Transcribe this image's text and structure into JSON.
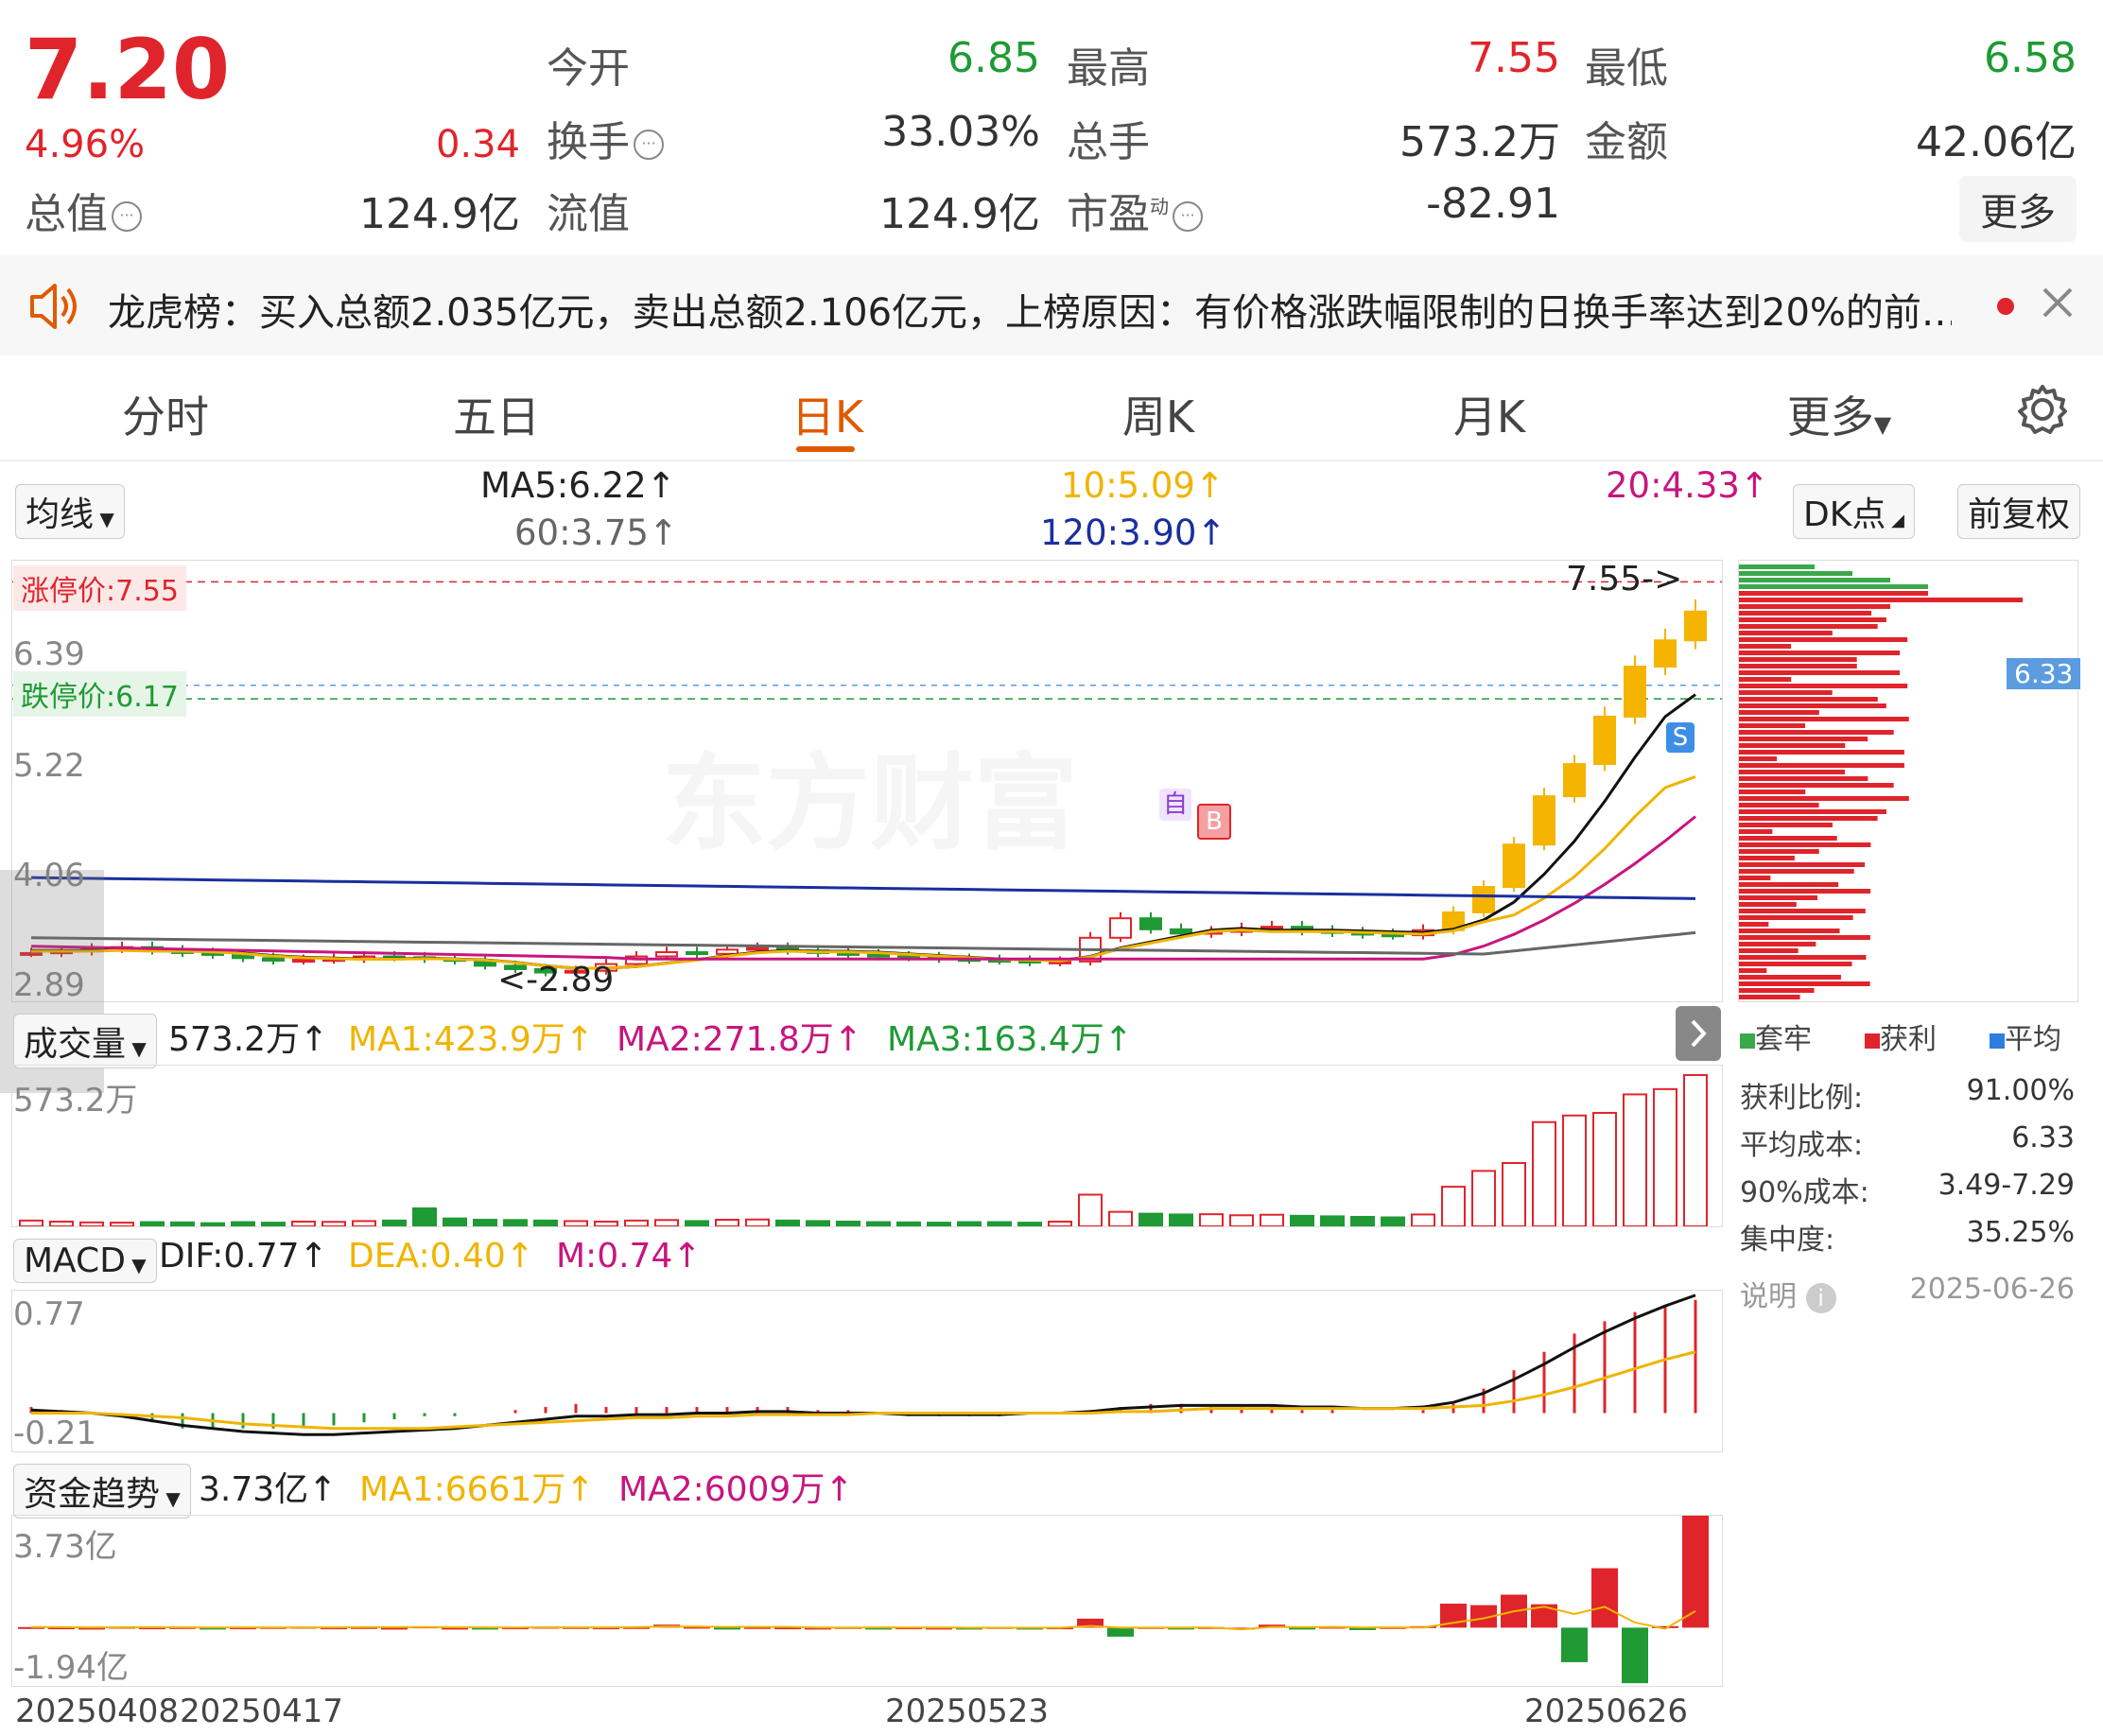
{
  "quote": {
    "price": "7.20",
    "change_pct": "4.96%",
    "change": "0.34",
    "total_value_label": "总值",
    "total_value": "124.9亿",
    "open_label": "今开",
    "open": "6.85",
    "high_label": "最高",
    "high": "7.55",
    "low_label": "最低",
    "low": "6.58",
    "turnover_label": "换手",
    "turnover": "33.03%",
    "volume_label": "总手",
    "volume": "573.2万",
    "amount_label": "金额",
    "amount": "42.06亿",
    "float_label": "流值",
    "float_value": "124.9亿",
    "pe_label": "市盈",
    "pe_sup": "动",
    "pe": "-82.91",
    "more_label": "更多"
  },
  "notice": {
    "text": "龙虎榜：买入总额2.035亿元，卖出总额2.106亿元，上榜原因：有价格涨跌幅限制的日换手率达到20%的前…",
    "dot_color": "#e0242b"
  },
  "tabs": [
    {
      "label": "分时"
    },
    {
      "label": "五日"
    },
    {
      "label": "日K"
    },
    {
      "label": "周K"
    },
    {
      "label": "月K"
    },
    {
      "label": "更多"
    }
  ],
  "active_tab": "日K",
  "ma_bar": {
    "selector": "均线",
    "ma5": "MA5:6.22↑",
    "ma10": "10:5.09↑",
    "ma20": "20:4.33↑",
    "ma60": "60:3.75↑",
    "ma120": "120:3.90↑",
    "dk_label": "DK点",
    "adjust_label": "前复权"
  },
  "kline": {
    "limit_up": "涨停价:7.55",
    "limit_down": "跌停价:6.17",
    "y_ticks": [
      "6.39",
      "5.22",
      "4.06",
      "2.89"
    ],
    "high_marker": "7.55->",
    "low_marker": "<-2.89",
    "watermark": "东方财富",
    "marker_s": "S",
    "marker_b": "B",
    "marker_zi": "自"
  },
  "chip": {
    "cost_tag": "6.33",
    "legend": [
      "套牢",
      "获利",
      "平均"
    ],
    "rows": [
      {
        "label": "获利比例:",
        "value": "91.00%"
      },
      {
        "label": "平均成本:",
        "value": "6.33"
      },
      {
        "label": "90%成本:",
        "value": "3.49-7.29"
      },
      {
        "label": "集中度:",
        "value": "35.25%"
      }
    ],
    "note_label": "说明",
    "date": "2025-06-26"
  },
  "volume_panel": {
    "selector": "成交量",
    "current": "573.2万↑",
    "ma1": "MA1:423.9万↑",
    "ma2": "MA2:271.8万↑",
    "ma3": "MA3:163.4万↑",
    "y_top": "573.2万"
  },
  "macd_panel": {
    "selector": "MACD",
    "dif": "DIF:0.77↑",
    "dea": "DEA:0.40↑",
    "m": "M:0.74↑",
    "y_top": "0.77",
    "y_bottom": "-0.21"
  },
  "fund_panel": {
    "selector": "资金趋势",
    "current": "3.73亿↑",
    "ma1": "MA1:6661万↑",
    "ma2": "MA2:6009万↑",
    "y_top": "3.73亿",
    "y_bottom": "-1.94亿"
  },
  "dates": [
    "20250408",
    "20250417",
    "20250523",
    "20250626"
  ],
  "colors": {
    "up": "#e0242b",
    "down": "#1f9a35",
    "accent": "#e05a00",
    "ma5": "#111111",
    "ma10": "#f0b400",
    "ma20": "#c8157e",
    "ma60": "#666666",
    "ma120": "#1a2f9e"
  },
  "chart_data": {
    "type": "line",
    "closes": [
      3.17,
      3.19,
      3.22,
      3.24,
      3.2,
      3.17,
      3.15,
      3.11,
      3.08,
      3.09,
      3.1,
      3.13,
      3.12,
      3.1,
      3.08,
      3.02,
      2.98,
      2.94,
      2.96,
      3.04,
      3.13,
      3.18,
      3.16,
      3.21,
      3.23,
      3.2,
      3.17,
      3.15,
      3.13,
      3.12,
      3.1,
      3.09,
      3.08,
      3.06,
      3.07,
      3.35,
      3.58,
      3.45,
      3.4,
      3.42,
      3.46,
      3.48,
      3.43,
      3.41,
      3.39,
      3.38,
      3.44,
      3.65,
      3.95,
      4.45,
      5.02,
      5.4,
      5.96,
      6.55,
      6.86,
      7.2
    ],
    "volume_wan": [
      22,
      18,
      15,
      14,
      16,
      15,
      12,
      16,
      14,
      18,
      17,
      20,
      22,
      68,
      30,
      25,
      24,
      22,
      20,
      18,
      22,
      24,
      20,
      25,
      26,
      22,
      20,
      18,
      16,
      15,
      14,
      16,
      16,
      14,
      18,
      120,
      55,
      48,
      45,
      46,
      42,
      44,
      40,
      38,
      36,
      34,
      45,
      150,
      210,
      240,
      395,
      420,
      430,
      500,
      520,
      573.2
    ],
    "macd_dif": [
      0.02,
      0.01,
      0.0,
      -0.02,
      -0.05,
      -0.08,
      -0.1,
      -0.12,
      -0.13,
      -0.14,
      -0.14,
      -0.13,
      -0.12,
      -0.11,
      -0.1,
      -0.08,
      -0.06,
      -0.04,
      -0.02,
      -0.02,
      -0.01,
      -0.01,
      0.0,
      0.0,
      0.01,
      0.01,
      0.0,
      0.0,
      0.0,
      -0.01,
      -0.01,
      -0.01,
      -0.01,
      0.0,
      0.0,
      0.01,
      0.03,
      0.04,
      0.05,
      0.05,
      0.05,
      0.05,
      0.04,
      0.04,
      0.03,
      0.03,
      0.04,
      0.07,
      0.13,
      0.22,
      0.32,
      0.43,
      0.53,
      0.62,
      0.7,
      0.77
    ],
    "macd_dea": [
      0.0,
      0.0,
      0.0,
      -0.01,
      -0.02,
      -0.03,
      -0.05,
      -0.07,
      -0.08,
      -0.09,
      -0.1,
      -0.1,
      -0.1,
      -0.1,
      -0.09,
      -0.08,
      -0.07,
      -0.06,
      -0.05,
      -0.04,
      -0.03,
      -0.03,
      -0.02,
      -0.02,
      -0.01,
      -0.01,
      -0.01,
      -0.01,
      0.0,
      0.0,
      0.0,
      0.0,
      0.0,
      0.0,
      0.0,
      0.0,
      0.01,
      0.01,
      0.02,
      0.03,
      0.03,
      0.03,
      0.03,
      0.03,
      0.03,
      0.03,
      0.03,
      0.04,
      0.05,
      0.08,
      0.12,
      0.17,
      0.23,
      0.29,
      0.35,
      0.4
    ],
    "fund_yi": [
      0.02,
      0.01,
      0.0,
      0.03,
      0.01,
      0.02,
      -0.03,
      0.01,
      0.02,
      0.03,
      0.01,
      0.02,
      0.0,
      0.04,
      0.0,
      -0.02,
      0.01,
      0.03,
      0.02,
      0.01,
      0.02,
      0.1,
      0.03,
      -0.04,
      0.02,
      0.01,
      0.0,
      0.02,
      -0.01,
      0.01,
      0.0,
      -0.03,
      0.02,
      -0.02,
      0.01,
      0.3,
      -0.3,
      0.02,
      -0.02,
      0.02,
      0.0,
      0.1,
      -0.02,
      0.03,
      -0.08,
      0.02,
      0.05,
      0.8,
      0.75,
      1.1,
      0.78,
      -1.15,
      1.98,
      -1.85,
      0.05,
      3.73
    ],
    "ma5": [
      3.2,
      3.2,
      3.2,
      3.21,
      3.2,
      3.2,
      3.19,
      3.17,
      3.14,
      3.12,
      3.11,
      3.1,
      3.1,
      3.11,
      3.1,
      3.09,
      3.06,
      3.02,
      2.99,
      2.99,
      3.01,
      3.05,
      3.09,
      3.14,
      3.18,
      3.2,
      3.19,
      3.19,
      3.18,
      3.16,
      3.14,
      3.12,
      3.1,
      3.09,
      3.08,
      3.13,
      3.23,
      3.3,
      3.37,
      3.44,
      3.46,
      3.44,
      3.44,
      3.44,
      3.43,
      3.42,
      3.41,
      3.45,
      3.56,
      3.77,
      4.1,
      4.49,
      4.96,
      5.48,
      5.96,
      6.22
    ],
    "ma10_val": "5.09",
    "ma20_val": "4.33",
    "ma60_val": "3.75",
    "ma120_val": "3.90"
  }
}
